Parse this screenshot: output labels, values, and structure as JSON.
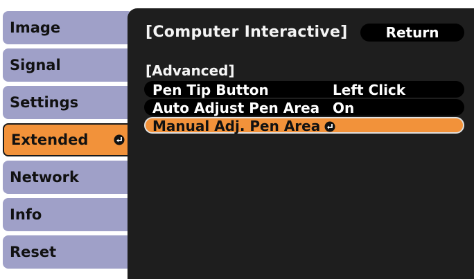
{
  "sidebar": {
    "items": [
      {
        "label": "Image"
      },
      {
        "label": "Signal"
      },
      {
        "label": "Settings"
      },
      {
        "label": "Extended",
        "active": true
      },
      {
        "label": "Network"
      },
      {
        "label": "Info"
      },
      {
        "label": "Reset"
      }
    ]
  },
  "panel": {
    "title": "[Computer Interactive]",
    "return_label": "Return",
    "section_label": "[Advanced]",
    "rows": [
      {
        "label": "Pen Tip Button",
        "value": "Left Click"
      },
      {
        "label": "Auto Adjust Pen Area",
        "value": "On"
      },
      {
        "label": "Manual Adj. Pen Area",
        "value": "",
        "selected": true
      }
    ]
  },
  "colors": {
    "sidebar_item": "#9fa0c8",
    "highlight": "#f2923a",
    "panel_bg": "#1e1e1e"
  },
  "icons": {
    "enter": "enter-icon"
  }
}
